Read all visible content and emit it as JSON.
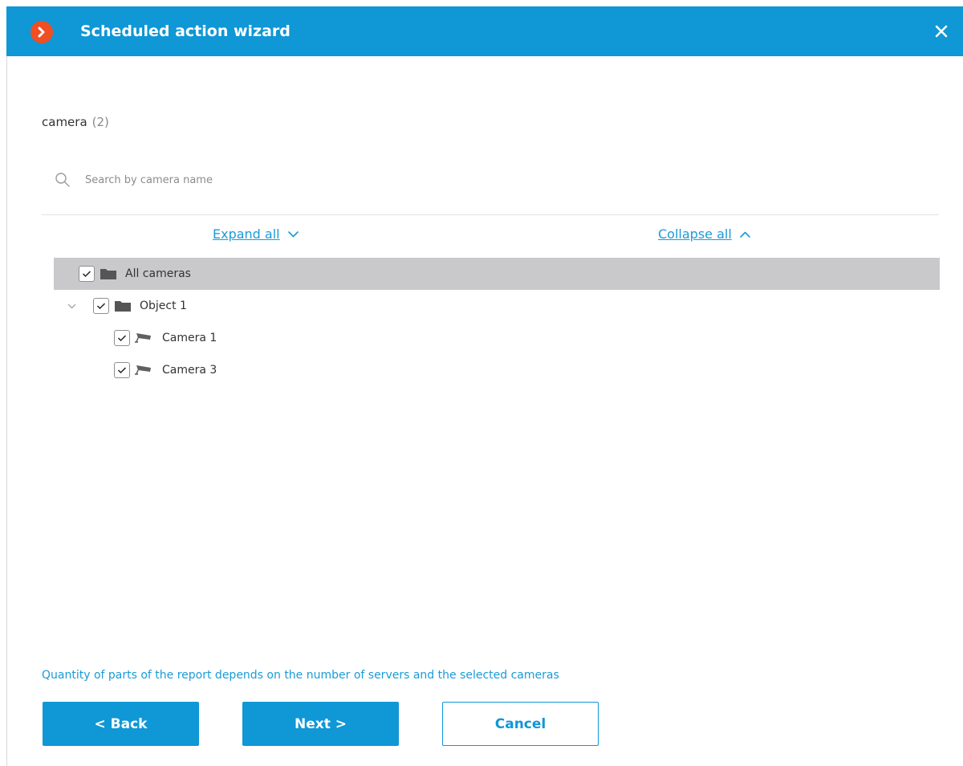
{
  "window": {
    "title": "Scheduled action wizard",
    "accent_color": "#0f97d6",
    "logo_color": "#f04e23",
    "logo_icon": "chevron-right-icon",
    "close_icon": "close-icon"
  },
  "section": {
    "label": "camera",
    "count": "(2)"
  },
  "search": {
    "placeholder": "Search by camera name",
    "value": "",
    "icon": "search-icon"
  },
  "tree_controls": {
    "expand_label": "Expand all",
    "collapse_label": "Collapse all"
  },
  "tree": {
    "items": [
      {
        "label": "All cameras",
        "checked": true,
        "icon": "folder-icon",
        "selected": true,
        "level": 0
      },
      {
        "label": "Object 1",
        "checked": true,
        "icon": "folder-icon",
        "selected": false,
        "level": 1,
        "expanded": true
      },
      {
        "label": "Camera 1",
        "checked": true,
        "icon": "camera-icon",
        "selected": false,
        "level": 2
      },
      {
        "label": "Camera 3",
        "checked": true,
        "icon": "camera-icon",
        "selected": false,
        "level": 2
      }
    ]
  },
  "note": "Quantity of parts of the report depends on the number of servers and the selected cameras",
  "buttons": {
    "back": "< Back",
    "next": "Next >",
    "cancel": "Cancel"
  }
}
